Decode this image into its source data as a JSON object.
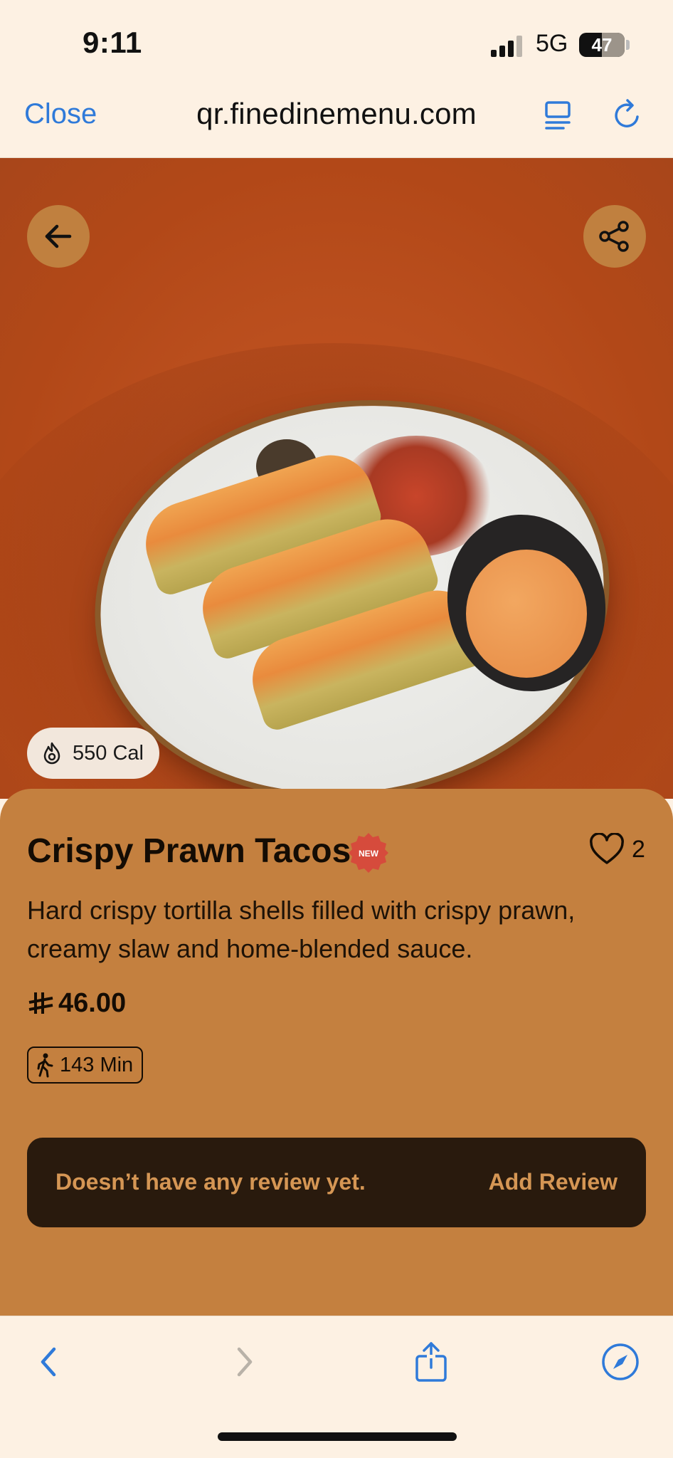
{
  "status_bar": {
    "time": "9:11",
    "network": "5G",
    "battery": "47"
  },
  "browser": {
    "close_label": "Close",
    "url": "qr.finedinemenu.com",
    "reader_icon": "reader-icon",
    "reload_icon": "reload-icon",
    "accent_color": "#2f7ad9"
  },
  "hero": {
    "back_icon": "arrow-left-icon",
    "share_icon": "share-icon",
    "calories": "550 Cal"
  },
  "item": {
    "title": "Crispy Prawn Tacos",
    "badge": "NEW",
    "likes": "2",
    "description": "Hard crispy tortilla shells filled with crispy prawn, creamy slaw and home-blended sauce.",
    "price": "46.00",
    "prep_time": "143 Min",
    "card_color": "#c4803f"
  },
  "review": {
    "empty_text": "Doesn’t have any review yet.",
    "add_label": "Add Review"
  },
  "toolbar": {
    "icons": [
      "back-chevron-icon",
      "forward-chevron-icon",
      "share-icon",
      "compass-icon"
    ]
  }
}
